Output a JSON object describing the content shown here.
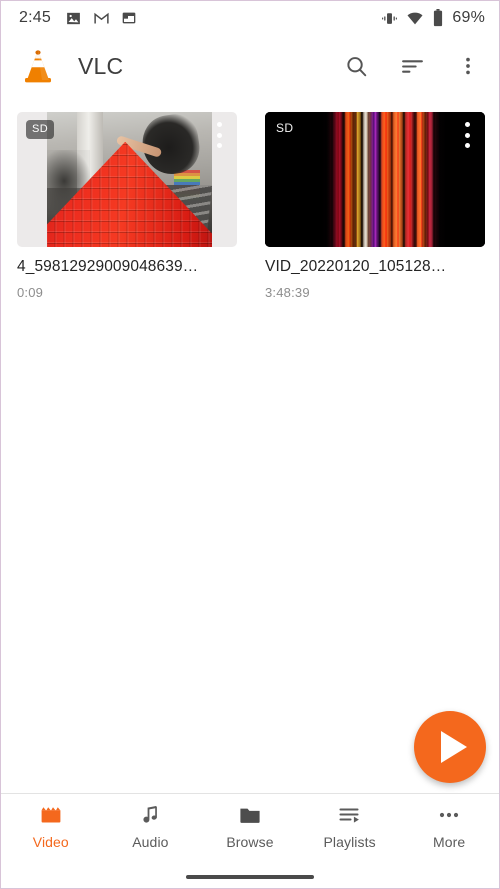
{
  "status_bar": {
    "time": "2:45",
    "left_icons": [
      "photos-icon",
      "gmail-icon",
      "calendar-icon"
    ],
    "right_icons": [
      "vibrate-icon",
      "wifi-icon",
      "battery-icon"
    ],
    "battery_text": "69%"
  },
  "app_bar": {
    "logo": "vlc-cone-logo",
    "title": "VLC",
    "actions": [
      {
        "name": "search-icon",
        "label": "Search"
      },
      {
        "name": "sort-icon",
        "label": "Sort"
      },
      {
        "name": "overflow-menu-icon",
        "label": "More options"
      }
    ]
  },
  "videos": [
    {
      "title": "4_59812929009048639…",
      "duration": "0:09",
      "quality_badge": "SD",
      "thumbnail": "red-cup-pyramid-thumbnail"
    },
    {
      "title": "VID_20220120_105128…",
      "duration": "3:48:39",
      "quality_badge": "SD",
      "thumbnail": "color-stripes-thumbnail"
    }
  ],
  "fab": {
    "name": "play-fab",
    "icon": "play-icon",
    "color": "#f4681d"
  },
  "bottom_nav": {
    "active": "Video",
    "active_color": "#f4681d",
    "inactive_color": "#5b5b5b",
    "items": [
      {
        "label": "Video",
        "icon": "clapperboard-icon"
      },
      {
        "label": "Audio",
        "icon": "music-note-icon"
      },
      {
        "label": "Browse",
        "icon": "folder-icon"
      },
      {
        "label": "Playlists",
        "icon": "playlist-icon"
      },
      {
        "label": "More",
        "icon": "more-dots-icon"
      }
    ]
  }
}
